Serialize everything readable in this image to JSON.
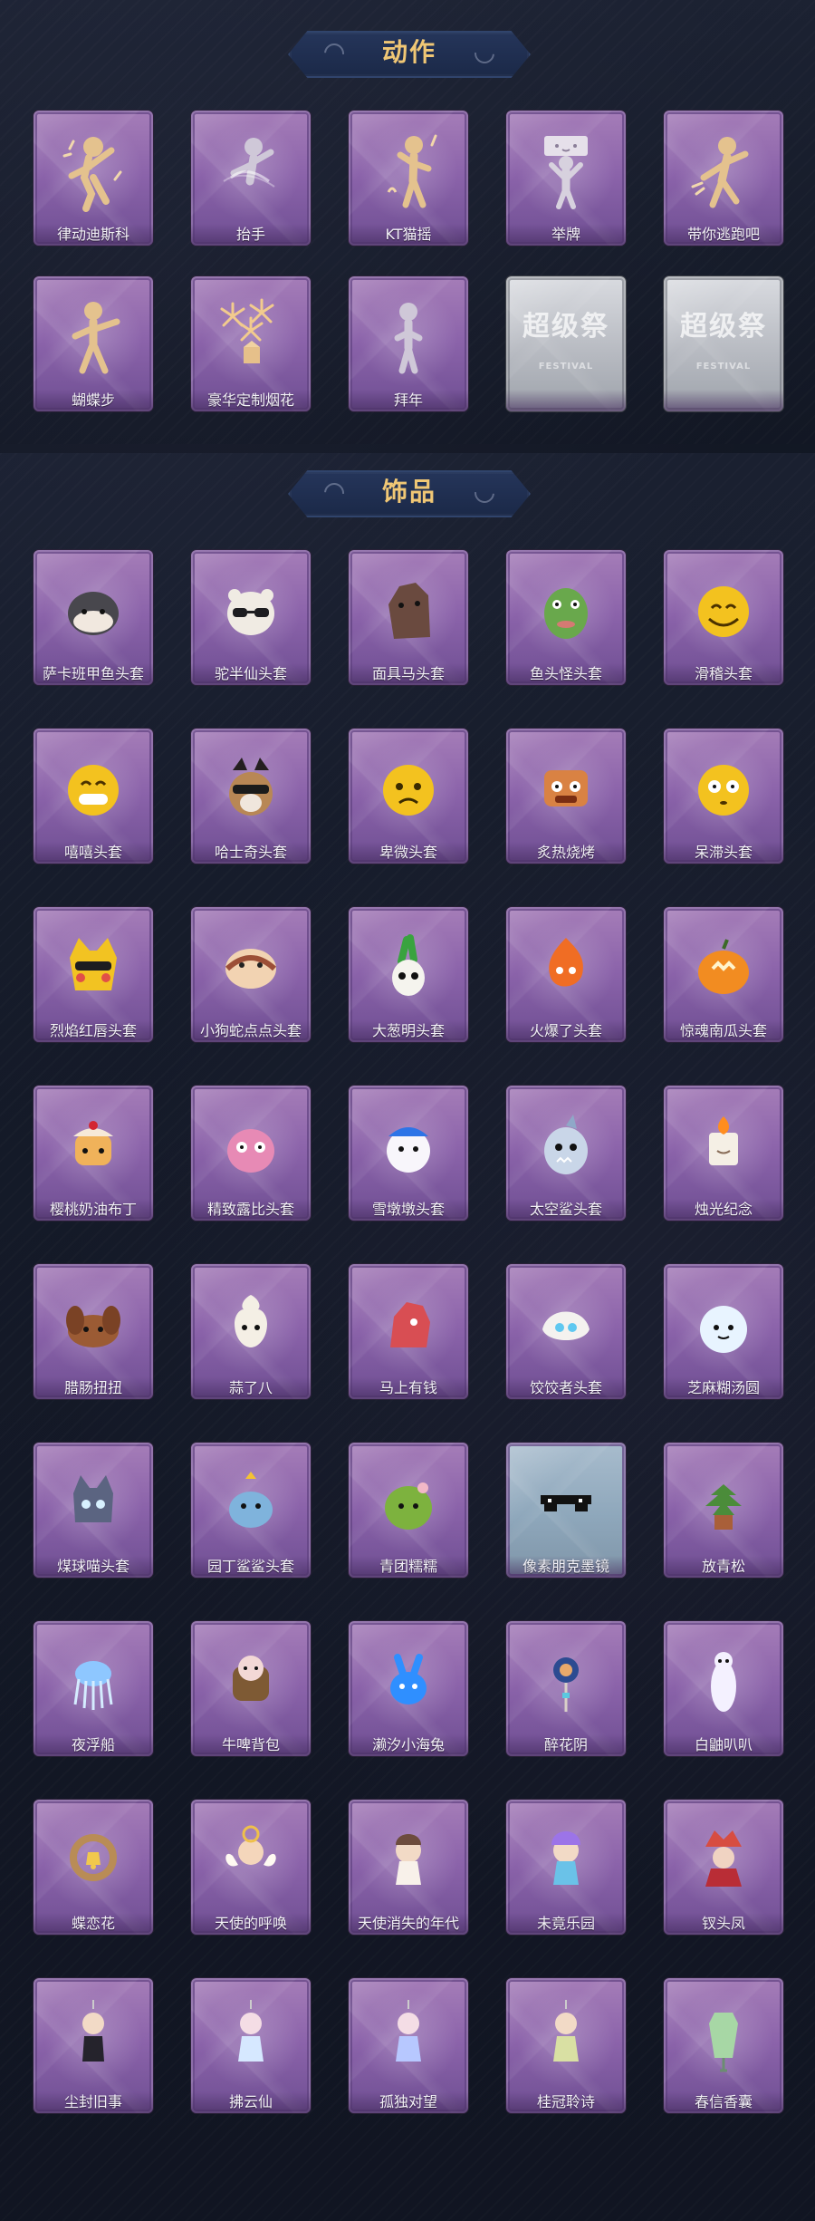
{
  "sections": {
    "actions": {
      "title": "动作",
      "items": [
        {
          "label": "律动迪斯科",
          "icon": "dance-pose-icon"
        },
        {
          "label": "抬手",
          "icon": "raise-hand-icon"
        },
        {
          "label": "KT猫摇",
          "icon": "cat-dance-icon"
        },
        {
          "label": "举牌",
          "icon": "sign-board-icon"
        },
        {
          "label": "带你逃跑吧",
          "icon": "run-away-icon"
        },
        {
          "label": "蝴蝶步",
          "icon": "butterfly-step-icon"
        },
        {
          "label": "豪华定制烟花",
          "icon": "fireworks-icon"
        },
        {
          "label": "拜年",
          "icon": "greeting-pose-icon"
        },
        {
          "label": "",
          "icon": "placeholder-logo-icon",
          "overlay": "超级祭",
          "overlay_sub": "FESTIVAL"
        },
        {
          "label": "",
          "icon": "placeholder-logo-icon",
          "overlay": "超级祭",
          "overlay_sub": "FESTIVAL"
        }
      ]
    },
    "decor": {
      "title": "饰品",
      "items": [
        {
          "label": "萨卡班甲鱼头套",
          "icon": "fish-mask-icon"
        },
        {
          "label": "驼半仙头套",
          "icon": "bear-glasses-icon"
        },
        {
          "label": "面具马头套",
          "icon": "horse-head-icon"
        },
        {
          "label": "鱼头怪头套",
          "icon": "fish-monster-icon"
        },
        {
          "label": "滑稽头套",
          "icon": "smiley-icon"
        },
        {
          "label": "嘻嘻头套",
          "icon": "grin-icon"
        },
        {
          "label": "哈士奇头套",
          "icon": "husky-icon"
        },
        {
          "label": "卑微头套",
          "icon": "sad-face-icon"
        },
        {
          "label": "炙热烧烤",
          "icon": "toast-monster-icon"
        },
        {
          "label": "呆滞头套",
          "icon": "stare-face-icon"
        },
        {
          "label": "烈焰红唇头套",
          "icon": "yellow-mask-icon"
        },
        {
          "label": "小狗蛇点点头套",
          "icon": "snake-face-icon"
        },
        {
          "label": "大葱明头套",
          "icon": "green-onion-icon"
        },
        {
          "label": "火爆了头套",
          "icon": "flame-face-icon"
        },
        {
          "label": "惊魂南瓜头套",
          "icon": "pumpkin-icon"
        },
        {
          "label": "樱桃奶油布丁",
          "icon": "pudding-icon"
        },
        {
          "label": "精致露比头套",
          "icon": "pink-creature-icon"
        },
        {
          "label": "雪墩墩头套",
          "icon": "snowman-icon"
        },
        {
          "label": "太空鲨头套",
          "icon": "space-shark-icon"
        },
        {
          "label": "烛光纪念",
          "icon": "candle-icon"
        },
        {
          "label": "腊肠扭扭",
          "icon": "sausage-dog-icon"
        },
        {
          "label": "蒜了八",
          "icon": "garlic-icon"
        },
        {
          "label": "马上有钱",
          "icon": "red-horse-icon"
        },
        {
          "label": "饺饺者头套",
          "icon": "dumpling-icon"
        },
        {
          "label": "芝麻糊汤圆",
          "icon": "rice-ball-icon"
        },
        {
          "label": "煤球喵头套",
          "icon": "cat-head-icon"
        },
        {
          "label": "园丁鲨鲨头套",
          "icon": "shark-bee-icon"
        },
        {
          "label": "青团糯糯",
          "icon": "green-bun-icon"
        },
        {
          "label": "像素朋克墨镜",
          "icon": "pixel-glasses-icon"
        },
        {
          "label": "放青松",
          "icon": "pine-bonsai-icon"
        },
        {
          "label": "夜浮船",
          "icon": "jellyfish-boat-icon"
        },
        {
          "label": "牛啤背包",
          "icon": "cow-backpack-icon"
        },
        {
          "label": "濑汐小海兔",
          "icon": "blue-bunny-icon"
        },
        {
          "label": "醉花阴",
          "icon": "flower-charm-icon"
        },
        {
          "label": "白鼬叭叭",
          "icon": "white-weasel-icon"
        },
        {
          "label": "蝶恋花",
          "icon": "bell-wreath-icon"
        },
        {
          "label": "天使的呼唤",
          "icon": "angel-charm-icon"
        },
        {
          "label": "天使消失的年代",
          "icon": "angel-girl-icon"
        },
        {
          "label": "未竟乐园",
          "icon": "fantasy-girl-icon"
        },
        {
          "label": "钗头凤",
          "icon": "phoenix-headdress-icon"
        },
        {
          "label": "尘封旧事",
          "icon": "old-story-charm-icon"
        },
        {
          "label": "拂云仙",
          "icon": "cloud-fairy-icon"
        },
        {
          "label": "孤独对望",
          "icon": "lonely-gaze-icon"
        },
        {
          "label": "桂冠聆诗",
          "icon": "poet-charm-icon"
        },
        {
          "label": "春信香囊",
          "icon": "sachet-icon"
        }
      ]
    }
  }
}
